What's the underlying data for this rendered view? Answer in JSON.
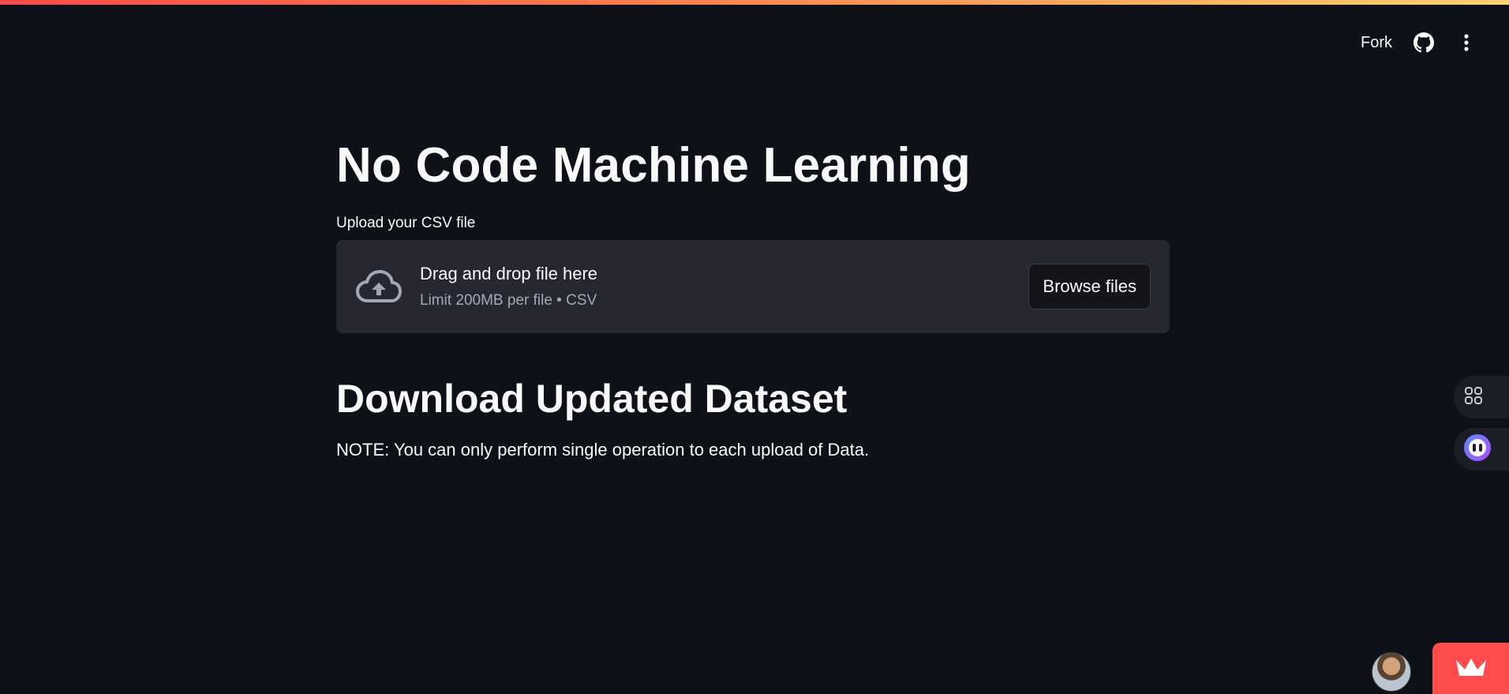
{
  "toolbar": {
    "fork_label": "Fork",
    "github_icon": "github-icon",
    "menu_icon": "more-vertical-icon"
  },
  "main": {
    "title": "No Code Machine Learning",
    "upload_label": "Upload your CSV file",
    "dropzone": {
      "icon": "cloud-upload-icon",
      "title": "Drag and drop file here",
      "subtitle": "Limit 200MB per file • CSV",
      "browse_label": "Browse files"
    },
    "section_heading": "Download Updated Dataset",
    "note": "NOTE: You can only perform single operation to each upload of Data."
  },
  "floating": {
    "shortcut_icon": "command-icon",
    "assistant_icon": "assistant-face-icon"
  },
  "footer": {
    "avatar_icon": "user-avatar",
    "badge_icon": "streamlit-crown-icon"
  },
  "colors": {
    "background": "#0e1117",
    "surface": "#262730",
    "text": "#fafafa",
    "muted": "#a3a8b4",
    "accent": "#ff4b4b"
  }
}
